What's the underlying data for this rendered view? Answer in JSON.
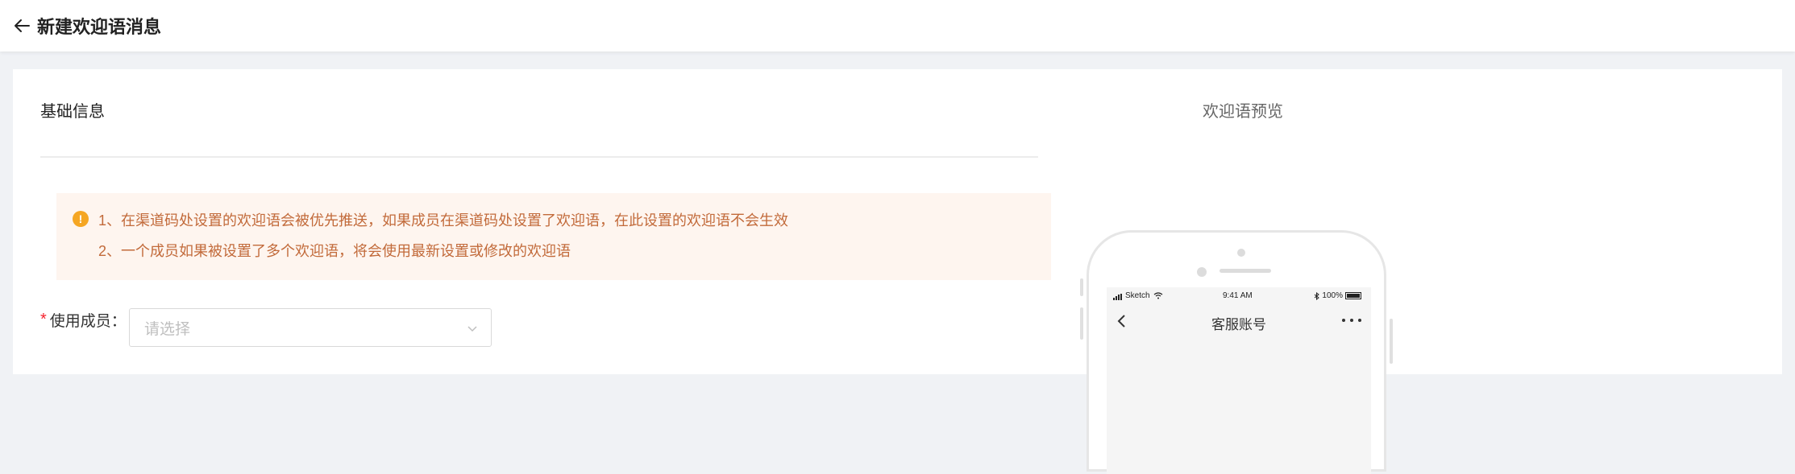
{
  "header": {
    "back_icon": "arrow-left-icon",
    "title": "新建欢迎语消息"
  },
  "basic_info": {
    "section_title": "基础信息",
    "notice": {
      "icon": "exclamation-circle-icon",
      "line1": "1、在渠道码处设置的欢迎语会被优先推送，如果成员在渠道码处设置了欢迎语，在此设置的欢迎语不会生效",
      "line2": "2、一个成员如果被设置了多个欢迎语，将会使用最新设置或修改的欢迎语"
    },
    "member_field": {
      "required_mark": "*",
      "label": "使用成员：",
      "placeholder": "请选择",
      "icon": "chevron-down-icon"
    }
  },
  "preview": {
    "title": "欢迎语预览",
    "phone": {
      "carrier": "Sketch",
      "time": "9:41 AM",
      "battery": "100%",
      "nav_title": "客服账号",
      "back_icon": "chevron-left-icon",
      "more_icon": "more-dots-icon"
    }
  },
  "colors": {
    "alert_background": "#fef5ef",
    "alert_text": "#c26a3a",
    "alert_icon": "#f5a623",
    "required": "#f5222d"
  }
}
